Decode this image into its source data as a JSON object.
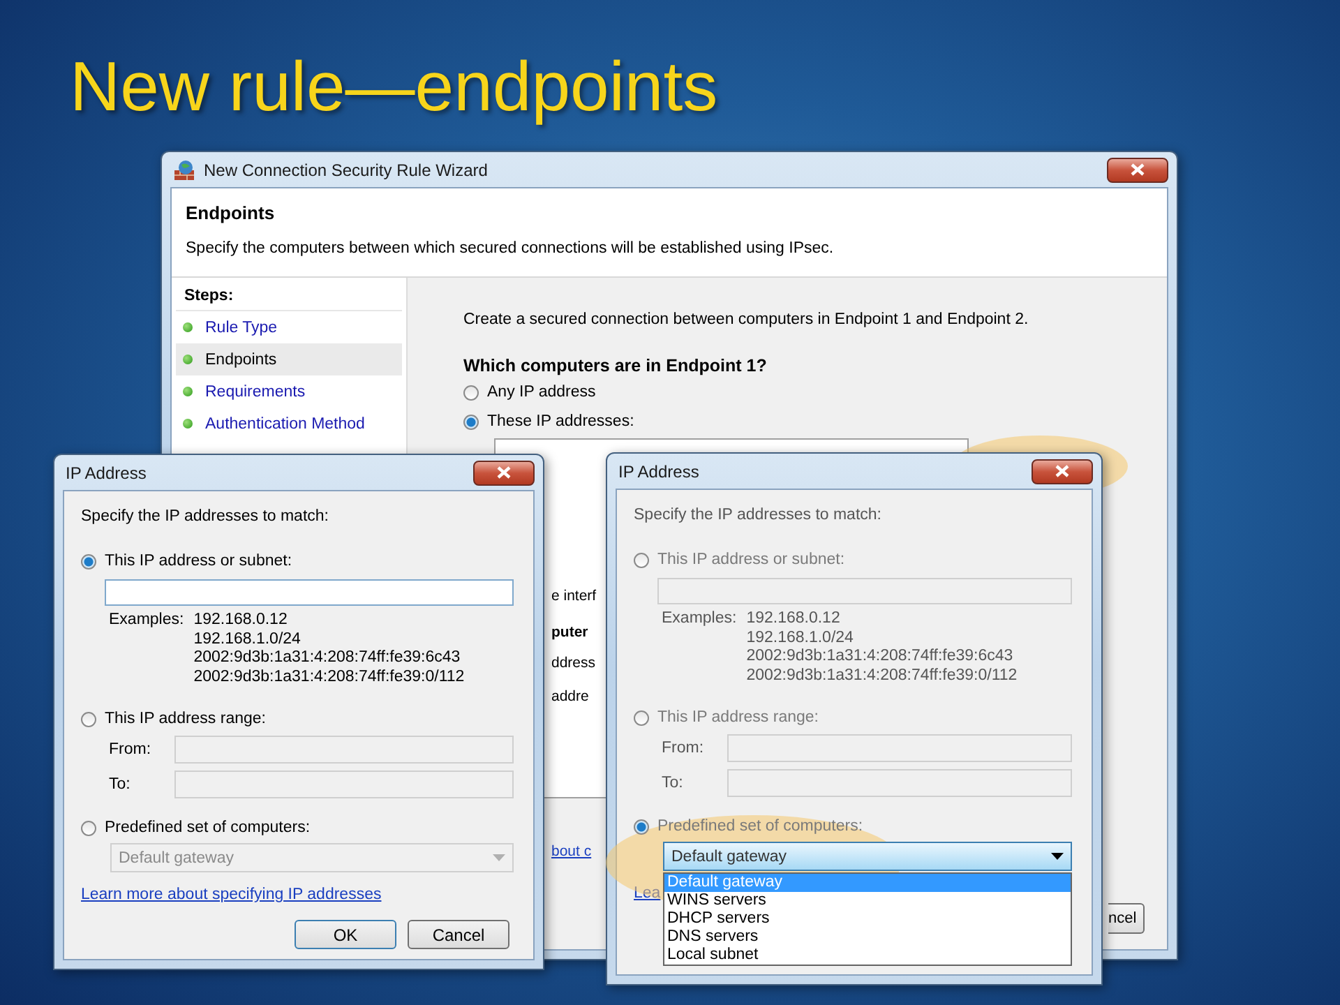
{
  "slide_title": "New rule—endpoints",
  "wizard": {
    "title": "New Connection Security Rule Wizard",
    "heading": "Endpoints",
    "description": "Specify the computers between which secured connections will be established using IPsec.",
    "steps_label": "Steps:",
    "steps": [
      {
        "label": "Rule Type",
        "selected": false
      },
      {
        "label": "Endpoints",
        "selected": true
      },
      {
        "label": "Requirements",
        "selected": false
      },
      {
        "label": "Authentication Method",
        "selected": false
      }
    ],
    "intro": "Create a secured connection between computers in Endpoint 1 and Endpoint 2.",
    "question": "Which computers are in Endpoint 1?",
    "options": [
      {
        "label": "Any IP address",
        "selected": false
      },
      {
        "label": "These IP addresses:",
        "selected": true
      }
    ],
    "add_highlighted": true,
    "fragments": [
      {
        "text": "e interf",
        "kind": "plain"
      },
      {
        "text": "puter",
        "kind": "bold"
      },
      {
        "text": "ddress",
        "kind": "plain"
      },
      {
        "text": "addre",
        "kind": "plain"
      },
      {
        "text": "bout c",
        "kind": "link"
      }
    ],
    "cancel_fragment": "ncel"
  },
  "dialogs": [
    {
      "title": "IP Address",
      "dimmed": false,
      "prompt": "Specify the IP addresses to match:",
      "subnet": {
        "label": "This IP address or subnet:",
        "selected": true,
        "disabled": false
      },
      "examples_label": "Examples:",
      "examples": [
        "192.168.0.12",
        "192.168.1.0/24",
        "2002:9d3b:1a31:4:208:74ff:fe39:6c43",
        "2002:9d3b:1a31:4:208:74ff:fe39:0/112"
      ],
      "range": {
        "label": "This IP address range:",
        "selected": false
      },
      "from_label": "From:",
      "to_label": "To:",
      "range_disabled": true,
      "predefined": {
        "label": "Predefined set of computers:",
        "selected": false,
        "highlighted": false
      },
      "combo": {
        "value": "Default gateway",
        "disabled": true,
        "open": false
      },
      "link": "Learn more about specifying IP addresses",
      "buttons": [
        "OK",
        "Cancel"
      ]
    },
    {
      "title": "IP Address",
      "dimmed": true,
      "prompt": "Specify the IP addresses to match:",
      "subnet": {
        "label": "This IP address or subnet:",
        "selected": false,
        "disabled": true
      },
      "examples_label": "Examples:",
      "examples": [
        "192.168.0.12",
        "192.168.1.0/24",
        "2002:9d3b:1a31:4:208:74ff:fe39:6c43",
        "2002:9d3b:1a31:4:208:74ff:fe39:0/112"
      ],
      "range": {
        "label": "This IP address range:",
        "selected": false
      },
      "from_label": "From:",
      "to_label": "To:",
      "range_disabled": true,
      "predefined": {
        "label": "Predefined set of computers:",
        "selected": true,
        "highlighted": true
      },
      "combo": {
        "value": "Default gateway",
        "disabled": false,
        "open": true,
        "options": [
          {
            "label": "Default gateway",
            "selected": true
          },
          {
            "label": "WINS servers",
            "selected": false
          },
          {
            "label": "DHCP servers",
            "selected": false
          },
          {
            "label": "DNS servers",
            "selected": false
          },
          {
            "label": "Local subnet",
            "selected": false
          }
        ]
      },
      "link": "Lea"
    }
  ]
}
